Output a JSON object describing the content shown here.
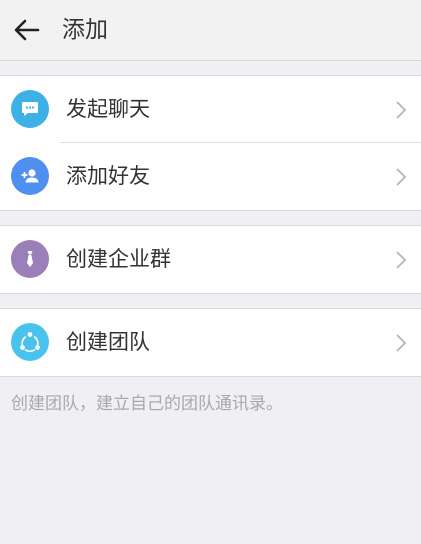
{
  "header": {
    "title": "添加"
  },
  "menu": {
    "start_chat": {
      "label": "发起聊天",
      "icon": "chat-bubble-icon",
      "color": "#3db0e6"
    },
    "add_friend": {
      "label": "添加好友",
      "icon": "add-person-icon",
      "color": "#4f8ff0"
    },
    "create_enterprise_group": {
      "label": "创建企业群",
      "icon": "tie-icon",
      "color": "#9a7fb8"
    },
    "create_team": {
      "label": "创建团队",
      "icon": "team-share-icon",
      "color": "#49c2ee"
    }
  },
  "footnote": "创建团队，建立自己的团队通讯录。"
}
